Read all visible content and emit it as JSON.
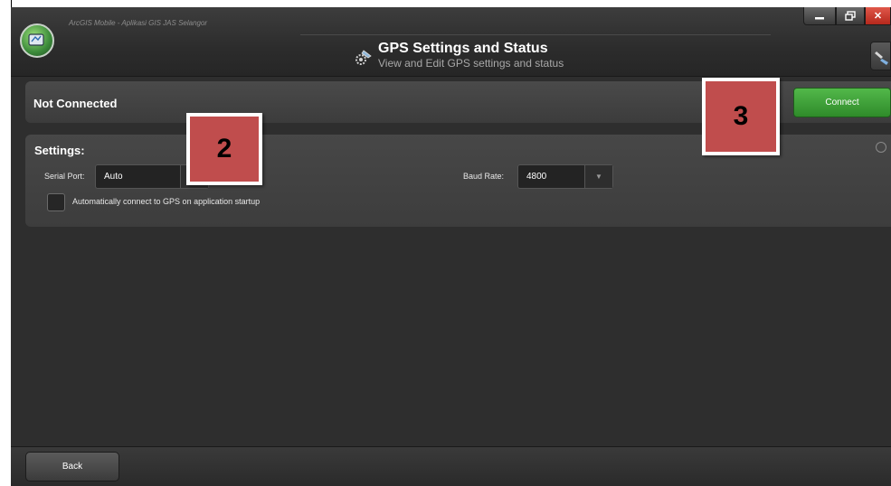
{
  "window": {
    "app_title": "ArcGIS Mobile - Aplikasi GIS JAS Selangor",
    "page_title": "GPS Settings and Status",
    "page_subtitle": "View and Edit GPS settings and status",
    "controls": {
      "minimize_icon": "minimize-icon",
      "maximize_icon": "restore-icon",
      "close_glyph": "✕"
    }
  },
  "status": {
    "text": "Not Connected",
    "connect_label": "Connect",
    "connect_color": "#3a9c34"
  },
  "settings": {
    "title": "Settings:",
    "serial_port_label": "Serial Port:",
    "serial_port_value": "Auto",
    "baud_rate_label": "Baud Rate:",
    "baud_rate_value": "4800",
    "auto_connect_label": "Automatically connect to GPS on application startup",
    "auto_connect_checked": false
  },
  "footer": {
    "back_label": "Back"
  },
  "callouts": [
    {
      "label": "2",
      "color": "#c04d4d"
    },
    {
      "label": "3",
      "color": "#c04d4d"
    }
  ]
}
